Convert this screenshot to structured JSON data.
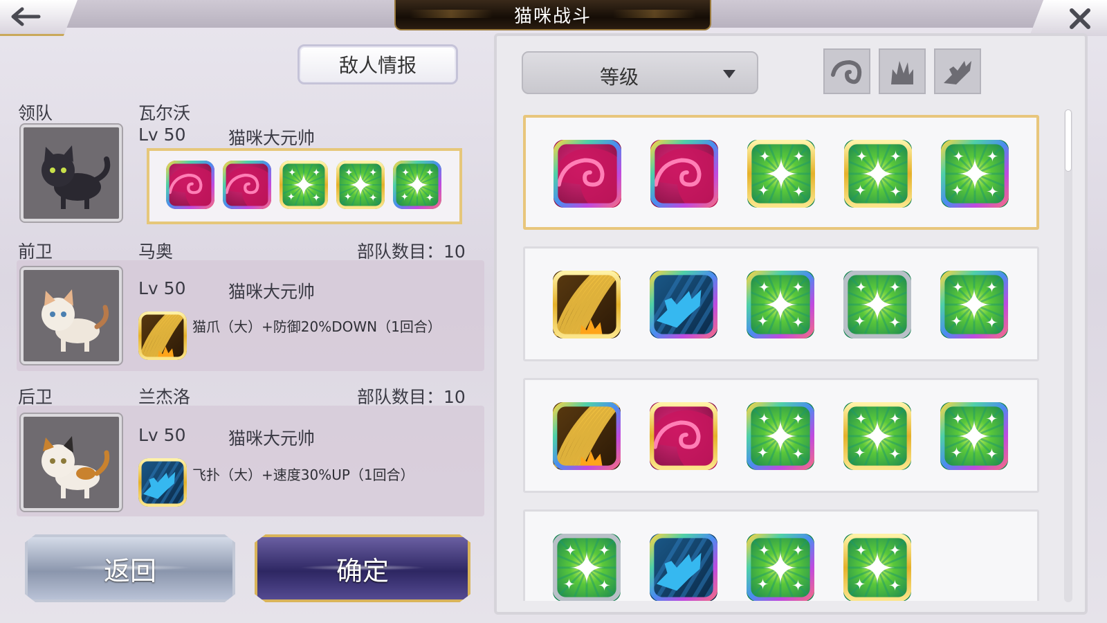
{
  "header": {
    "title": "猫咪战斗",
    "back_icon": "arrow-left-icon",
    "close_icon": "close-icon"
  },
  "left": {
    "enemy_info_label": "敌人情报",
    "leader": {
      "role": "领队",
      "name": "瓦尔沃",
      "level": "Lv 50",
      "rank": "猫咪大元帅",
      "skills": [
        "claw-pink",
        "claw-pink",
        "sparkle-green",
        "sparkle-green",
        "sparkle-green"
      ]
    },
    "front": {
      "role": "前卫",
      "name": "马奥",
      "count": "部队数目：10",
      "level": "Lv 50",
      "rank": "猫咪大元帅",
      "skill_icon": "scratch-gold",
      "skill_text": "猫爪（大）+防御20%DOWN（1回合）"
    },
    "rear": {
      "role": "后卫",
      "name": "兰杰洛",
      "count": "部队数目：10",
      "level": "Lv 50",
      "rank": "猫咪大元帅",
      "skill_icon": "pounce-blue",
      "skill_text": "飞扑（大）+速度30%UP（1回合）"
    },
    "return_label": "返回",
    "confirm_label": "确定"
  },
  "right": {
    "sort_label": "等级",
    "filters": [
      "claw-filter-icon",
      "scratch-filter-icon",
      "pounce-filter-icon"
    ],
    "teams": [
      {
        "selected": true,
        "icons": [
          "claw-pink",
          "claw-pink",
          "sparkle-green",
          "sparkle-green",
          "sparkle-green"
        ]
      },
      {
        "selected": false,
        "icons": [
          "scratch-gold",
          "pounce-blue",
          "sparkle-green",
          "sparkle-green",
          "sparkle-green"
        ]
      },
      {
        "selected": false,
        "icons": [
          "scratch-gold",
          "claw-pink",
          "sparkle-green",
          "sparkle-green",
          "sparkle-green"
        ]
      },
      {
        "selected": false,
        "icons": [
          "sparkle-green",
          "pounce-blue",
          "sparkle-green",
          "sparkle-green"
        ]
      }
    ]
  },
  "colors": {
    "gold_frame": "#e6c77a",
    "rainbow_frame": "rainbow",
    "confirm_bg": "#2e2763"
  }
}
